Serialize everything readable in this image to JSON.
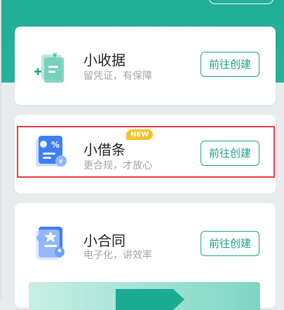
{
  "cards": [
    {
      "title": "小收据",
      "subtitle": "留凭证，有保障",
      "button": "前往创建",
      "icon": "receipt-yuan-icon"
    },
    {
      "title": "小借条",
      "subtitle": "更合规，才放心",
      "button": "前往创建",
      "badge": "NEW",
      "icon": "iou-percent-icon"
    },
    {
      "title": "小合同",
      "subtitle": "电子化，讲效率",
      "button": "前往创建",
      "icon": "contract-star-icon"
    }
  ],
  "colors": {
    "accent": "#1aa08a",
    "header": "#1fae96",
    "badge": "#f3c22a",
    "highlight": "#e43a3a"
  }
}
